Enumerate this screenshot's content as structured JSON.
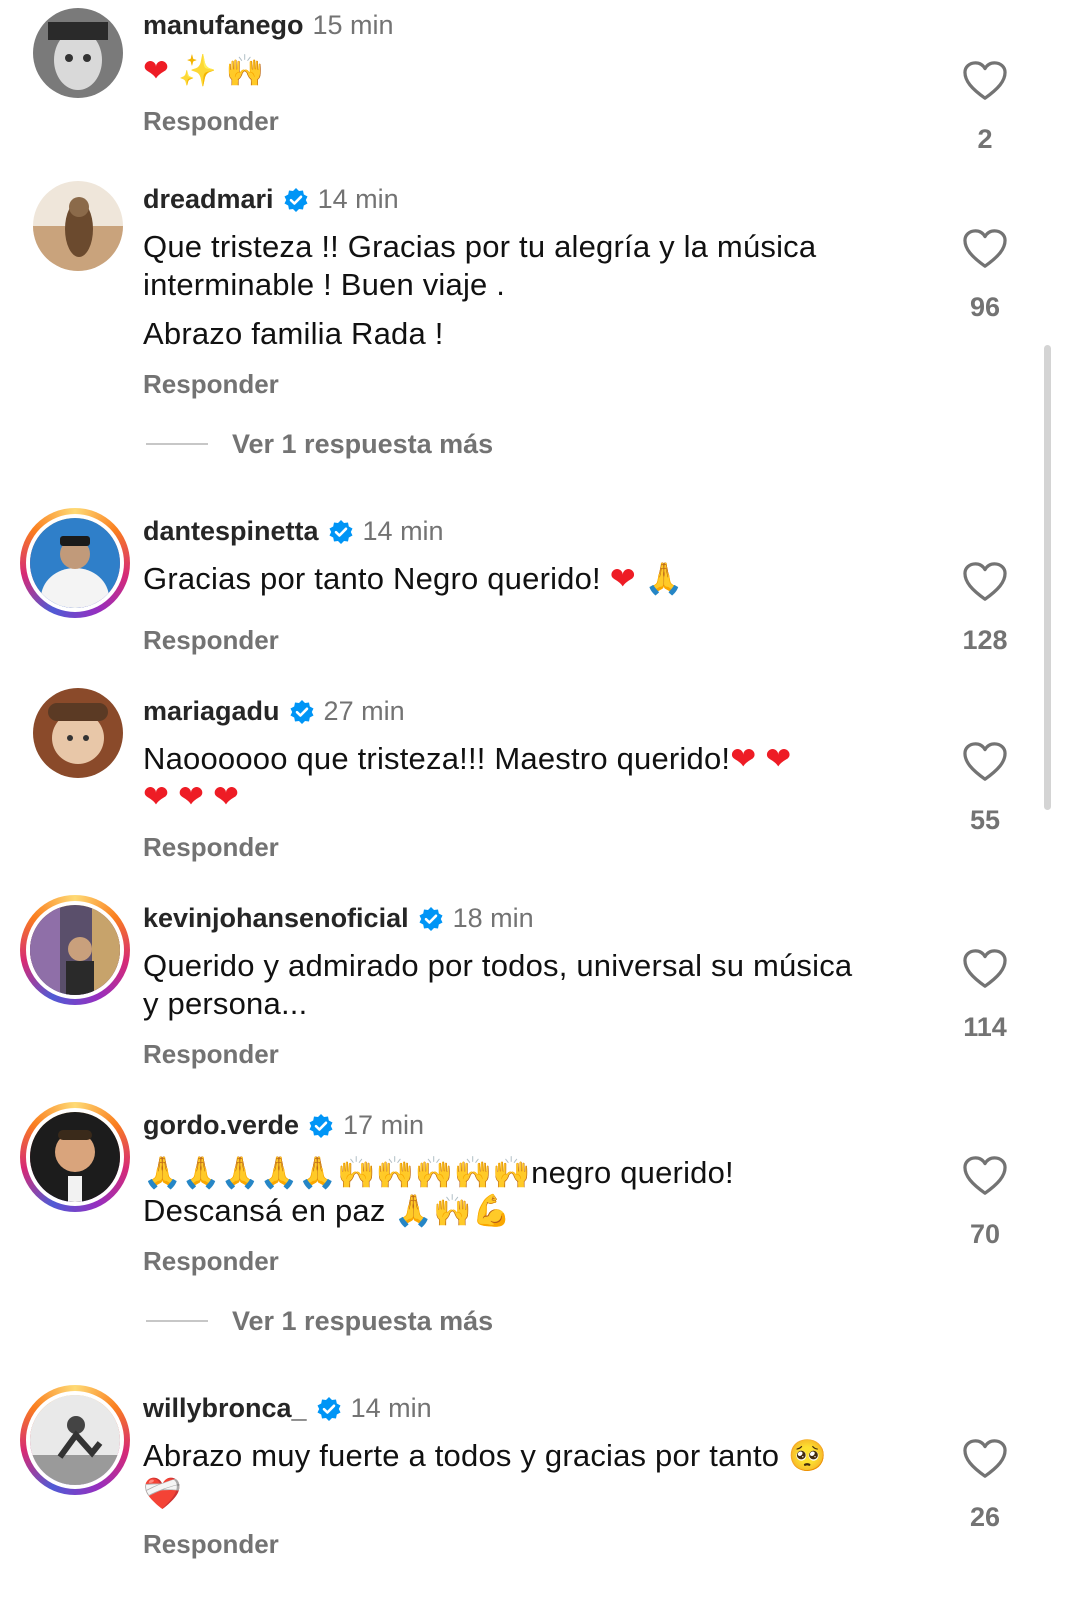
{
  "reply_label": "Responder",
  "more_replies_label": "Ver 1 respuesta más",
  "comments": [
    {
      "username": "manufanego",
      "verified": false,
      "time": "15 min",
      "lines": [
        ""
      ],
      "emojis": [
        "❤",
        "✨",
        "🙌"
      ],
      "likes": "2"
    },
    {
      "username": "dreadmari",
      "verified": true,
      "time": "14 min",
      "lines": [
        "Que tristeza !! Gracias por tu alegría y la música interminable !  Buen viaje .",
        "Abrazo familia Rada !"
      ],
      "likes": "96"
    },
    {
      "username": "dantespinetta",
      "verified": true,
      "time": "14 min",
      "lines": [
        "Gracias por tanto Negro querido! "
      ],
      "emojis": [
        "❤",
        "🙏"
      ],
      "likes": "128"
    },
    {
      "username": "mariagadu",
      "verified": true,
      "time": "27 min",
      "lines": [
        "Naoooooo que tristeza!!! Maestro querido!"
      ],
      "emojis": [
        "❤",
        "❤",
        "❤",
        "❤",
        "❤"
      ],
      "likes": "55"
    },
    {
      "username": "kevinjohansenoficial",
      "verified": true,
      "time": "18 min",
      "lines": [
        "Querido y admirado por todos, universal su música y persona..."
      ],
      "likes": "114"
    },
    {
      "username": "gordo.verde",
      "verified": true,
      "time": "17 min",
      "line_a": "negro querido!",
      "line_b": "Descansá en paz ",
      "emojis_a": [
        "🙏",
        "🙏",
        "🙏",
        "🙏",
        "🙏",
        "🙌",
        "🙌",
        "🙌",
        "🙌",
        "🙌"
      ],
      "emojis_b": [
        "🙏",
        "🙌",
        "💪"
      ],
      "likes": "70"
    },
    {
      "username": "willybronca_",
      "verified": true,
      "time": "14 min",
      "lines": [
        "Abrazo muy fuerte a todos y gracias por tanto "
      ],
      "emojis": [
        "🥺",
        "❤️‍🩹"
      ],
      "likes": "26"
    }
  ],
  "colors": {
    "verified_blue": "#0095f6",
    "heart_red": "#ee1c25",
    "secondary_text": "#737373"
  },
  "icons": {
    "like": "heart-outline-icon",
    "verified": "verified-badge-icon"
  }
}
